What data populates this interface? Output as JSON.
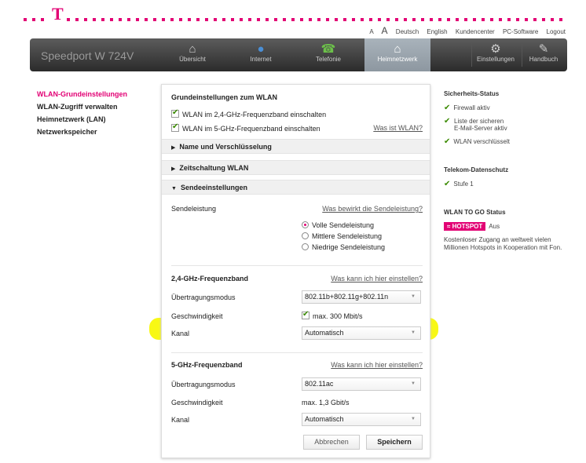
{
  "top_links": {
    "font_small": "A",
    "font_large": "A",
    "lang_de": "Deutsch",
    "lang_en": "English",
    "customer_center": "Kundencenter",
    "pc_software": "PC-Software",
    "logout": "Logout"
  },
  "logo_letter": "T",
  "brand": "Speedport W 724V",
  "nav": [
    {
      "label": "Übersicht",
      "icon": "home-icon",
      "glyph": "⌂"
    },
    {
      "label": "Internet",
      "icon": "globe-icon",
      "glyph": "●"
    },
    {
      "label": "Telefonie",
      "icon": "phone-icon",
      "glyph": "☎"
    },
    {
      "label": "Heimnetzwerk",
      "icon": "home-network-icon",
      "glyph": "⌂"
    },
    {
      "label": "Einstellungen",
      "icon": "gear-icon",
      "glyph": "⚙"
    },
    {
      "label": "Handbuch",
      "icon": "book-icon",
      "glyph": "✎"
    }
  ],
  "left_menu": {
    "items": [
      "WLAN-Grundeinstellungen",
      "WLAN-Zugriff verwalten",
      "Heimnetzwerk (LAN)",
      "Netzwerkspeicher"
    ]
  },
  "main": {
    "basic_title": "Grundeinstellungen zum WLAN",
    "cb_24": "WLAN im 2,4-GHz-Frequenzband einschalten",
    "cb_5": "WLAN im 5-GHz-Frequenzband einschalten",
    "what_is_wlan": "Was ist WLAN?",
    "acc_name": "Name und Verschlüsselung",
    "acc_timer": "Zeitschaltung WLAN",
    "acc_send": "Sendeeinstellungen",
    "send_power_label": "Sendeleistung",
    "send_power_link": "Was bewirkt die Sendeleistung?",
    "radio_full": "Volle Sendeleistung",
    "radio_mid": "Mittlere Sendeleistung",
    "radio_low": "Niedrige Sendeleistung",
    "band24_title": "2,4-GHz-Frequenzband",
    "band24_link": "Was kann ich hier einstellen?",
    "band24_mode_label": "Übertragungsmodus",
    "band24_mode_value": "802.11b+802.11g+802.11n",
    "band24_speed_label": "Geschwindigkeit",
    "band24_speed_value": "max. 300 Mbit/s",
    "band24_channel_label": "Kanal",
    "band24_channel_value": "Automatisch",
    "band5_title": "5-GHz-Frequenzband",
    "band5_link": "Was kann ich hier einstellen?",
    "band5_mode_label": "Übertragungsmodus",
    "band5_mode_value": "802.11ac",
    "band5_speed_label": "Geschwindigkeit",
    "band5_speed_value": "max. 1,3 Gbit/s",
    "band5_channel_label": "Kanal",
    "band5_channel_value": "Automatisch",
    "cancel": "Abbrechen",
    "save": "Speichern"
  },
  "right": {
    "security_title": "Sicherheits-Status",
    "firewall": "Firewall aktiv",
    "mailserver_line1": "Liste der sicheren",
    "mailserver_line2": "E-Mail-Server aktiv",
    "wlan_enc": "WLAN verschlüsselt",
    "privacy_title": "Telekom-Datenschutz",
    "privacy_level": "Stufe 1",
    "togo_title": "WLAN TO GO Status",
    "hotspot_badge": "HOTSPOT",
    "hotspot_state": "Aus",
    "togo_desc": "Kostenloser Zugang an weltweit vielen Millionen Hotspots in Kooperation mit Fon."
  },
  "colors": {
    "accent": "#e20074",
    "highlight": "#f7f700",
    "check": "#3a8a00"
  }
}
